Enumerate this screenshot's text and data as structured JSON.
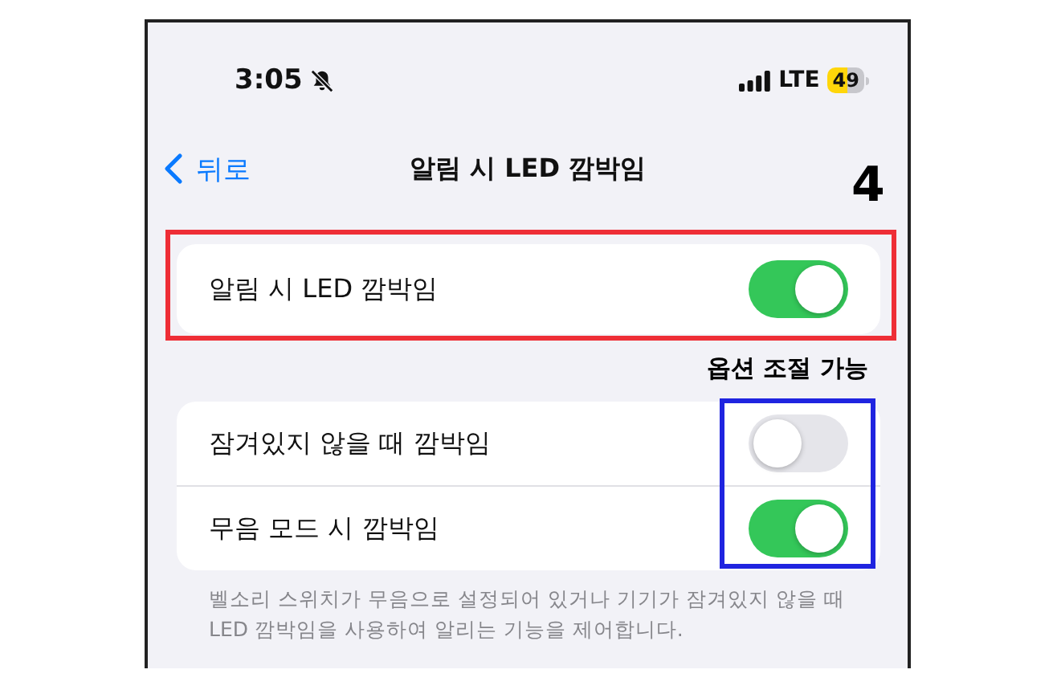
{
  "status_bar": {
    "time": "3:05",
    "silent": true,
    "network": "LTE",
    "battery": "49",
    "low_power": true
  },
  "nav": {
    "back_label": "뒤로",
    "title": "알림 시 LED 깜박임"
  },
  "groups": [
    {
      "rows": [
        {
          "label": "알림 시 LED 깜박임",
          "on": true
        }
      ]
    },
    {
      "rows": [
        {
          "label": "잠겨있지 않을 때 깜박임",
          "on": false
        },
        {
          "label": "무음 모드 시 깜박임",
          "on": true
        }
      ],
      "footer": "벨소리 스위치가 무음으로 설정되어 있거나 기기가 잠겨있지 않을 때 LED 깜박임을 사용하여 알리는 기능을 제어합니다."
    }
  ],
  "annotations": {
    "step": "4",
    "note": "옵션 조절 가능",
    "highlights": [
      {
        "kind": "group",
        "color": "#ee2e36"
      },
      {
        "kind": "toggles",
        "color": "#1f24e0"
      }
    ]
  }
}
